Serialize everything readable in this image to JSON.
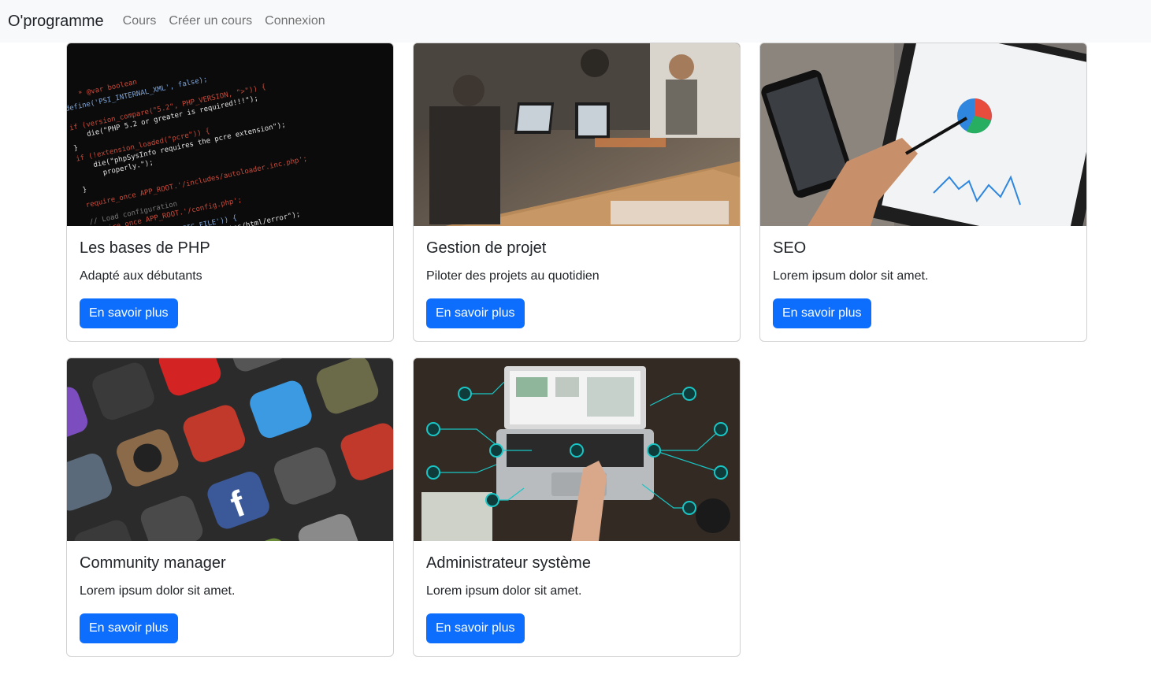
{
  "nav": {
    "brand": "O'programme",
    "links": [
      "Cours",
      "Créer un cours",
      "Connexion"
    ]
  },
  "cards": [
    {
      "title": "Les bases de PHP",
      "text": "Adapté aux débutants",
      "button": "En savoir plus",
      "image": "php-code-screenshot"
    },
    {
      "title": "Gestion de projet",
      "text": "Piloter des projets au quotidien",
      "button": "En savoir plus",
      "image": "team-meeting-laptops"
    },
    {
      "title": "SEO",
      "text": "Lorem ipsum dolor sit amet.",
      "button": "En savoir plus",
      "image": "tablet-analytics-dashboard"
    },
    {
      "title": "Community manager",
      "text": "Lorem ipsum dolor sit amet.",
      "button": "En savoir plus",
      "image": "social-media-app-icons"
    },
    {
      "title": "Administrateur système",
      "text": "Lorem ipsum dolor sit amet.",
      "button": "En savoir plus",
      "image": "laptop-network-nodes"
    }
  ],
  "colors": {
    "primary": "#0d6efd",
    "navbar_bg": "#f8f9fa"
  }
}
